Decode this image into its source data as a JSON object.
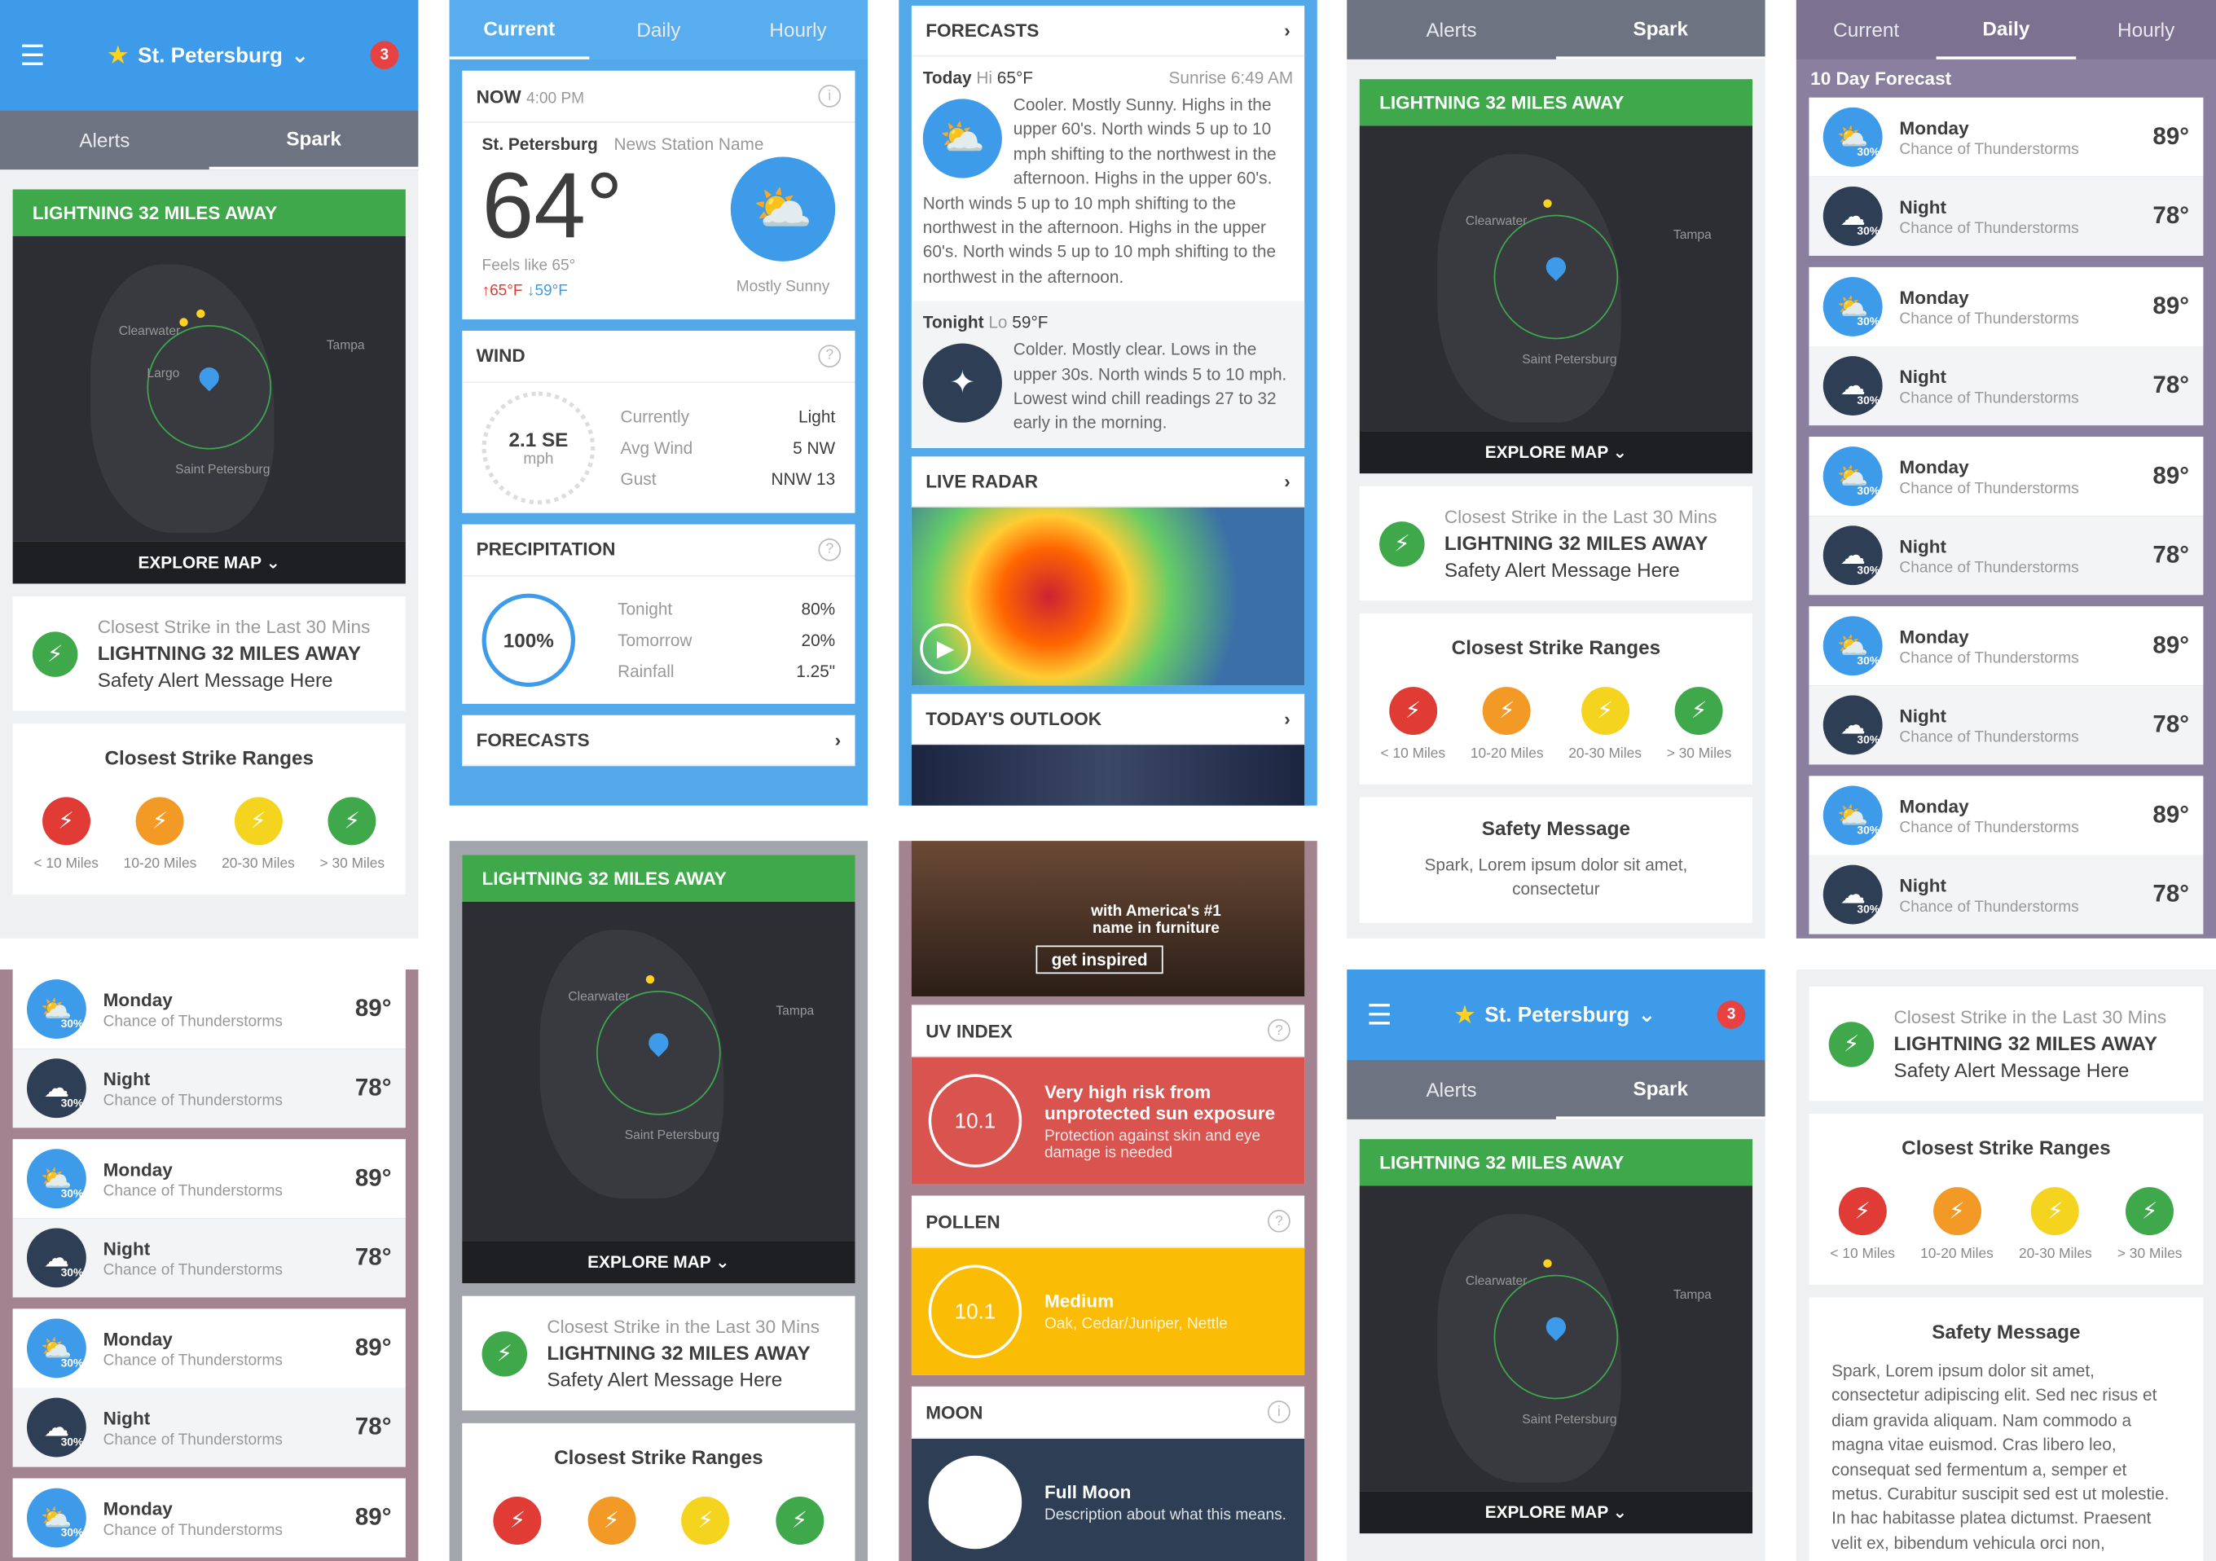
{
  "header": {
    "location": "St. Petersburg",
    "badge": "3"
  },
  "tabs_spark": {
    "alerts": "Alerts",
    "spark": "Spark"
  },
  "tabs_main": {
    "current": "Current",
    "daily": "Daily",
    "hourly": "Hourly"
  },
  "lightning": {
    "banner": "LIGHTNING 32 MILES AWAY",
    "explore": "EXPLORE MAP",
    "closest_title": "Closest Strike in the Last 30 Mins",
    "closest_main": "LIGHTNING 32 MILES AWAY",
    "closest_msg": "Safety Alert Message Here",
    "ranges_title": "Closest Strike Ranges",
    "ranges": [
      {
        "label": "< 10 Miles",
        "color": "#e03b35"
      },
      {
        "label": "10-20 Miles",
        "color": "#f39a26"
      },
      {
        "label": "20-30 Miles",
        "color": "#f5d420"
      },
      {
        "label": "> 30 Miles",
        "color": "#3ea84b"
      }
    ],
    "map_labels": {
      "clearwater": "Clearwater",
      "largo": "Largo",
      "tampa": "Tampa",
      "stpete": "Saint Petersburg"
    },
    "safety_title": "Safety Message",
    "safety_short": "Spark, Lorem ipsum dolor sit amet, consectetur",
    "safety_long": "Spark, Lorem ipsum dolor sit amet, consectetur adipiscing elit. Sed nec risus et diam gravida aliquam. Nam commodo a magna vitae euismod. Cras libero leo, consequat sed fermentum a, semper et metus. Curabitur suscipit sed est ut molestie. In hac habitasse platea dictumst. Praesent velit ex, bibendum vehicula orci non,"
  },
  "ten_day": {
    "title": "10 Day Forecast",
    "day": "Monday",
    "night": "Night",
    "cond": "Chance of Thunderstorms",
    "hi": "89°",
    "lo": "78°",
    "pct": "30%"
  },
  "now": {
    "title": "NOW",
    "time": "4:00 PM",
    "city": "St. Petersburg",
    "station": "News Station Name",
    "temp": "64°",
    "feels": "Feels like 65°",
    "hi": "↑65°F",
    "lo": "↓59°F",
    "cond": "Mostly Sunny"
  },
  "wind": {
    "title": "WIND",
    "speed": "2.1 SE",
    "unit": "mph",
    "rows": [
      [
        "Currently",
        "Light"
      ],
      [
        "Avg Wind",
        "5 NW"
      ],
      [
        "Gust",
        "NNW 13"
      ]
    ]
  },
  "precip": {
    "title": "PRECIPITATION",
    "pct": "100%",
    "rows": [
      [
        "Tonight",
        "80%"
      ],
      [
        "Tomorrow",
        "20%"
      ],
      [
        "Rainfall",
        "1.25\""
      ]
    ]
  },
  "forecasts": {
    "title": "FORECASTS",
    "today": "Today",
    "hi_label": "Hi",
    "hi": "65°F",
    "sunrise": "Sunrise 6:49 AM",
    "today_text": "Cooler. Mostly Sunny. Highs in the upper 60's. North winds 5 up to 10 mph shifting to the northwest in the afternoon. Highs in the upper 60's. North winds 5 up to 10 mph shifting to the northwest in the afternoon. Highs in the upper 60's. North winds 5 up to 10 mph shifting to the northwest in the afternoon.",
    "tonight": "Tonight",
    "lo_label": "Lo",
    "lo": "59°F",
    "tonight_text": "Colder. Mostly clear. Lows in the upper 30s. North winds 5 to 10 mph. Lowest wind chill readings 27 to 32 early in the morning."
  },
  "radar": {
    "title": "LIVE RADAR"
  },
  "outlook": {
    "title": "TODAY'S OUTLOOK"
  },
  "ad": {
    "text": "with America's #1 name in furniture",
    "cta": "get inspired"
  },
  "uv": {
    "title": "UV INDEX",
    "value": "10.1",
    "head": "Very high risk from unprotected sun exposure",
    "desc": "Protection against skin and eye damage is needed"
  },
  "pollen": {
    "title": "POLLEN",
    "value": "10.1",
    "level": "Medium",
    "types": "Oak, Cedar/Juniper, Nettle"
  },
  "moon": {
    "title": "MOON",
    "phase": "Full Moon",
    "desc": "Description about what this means."
  }
}
